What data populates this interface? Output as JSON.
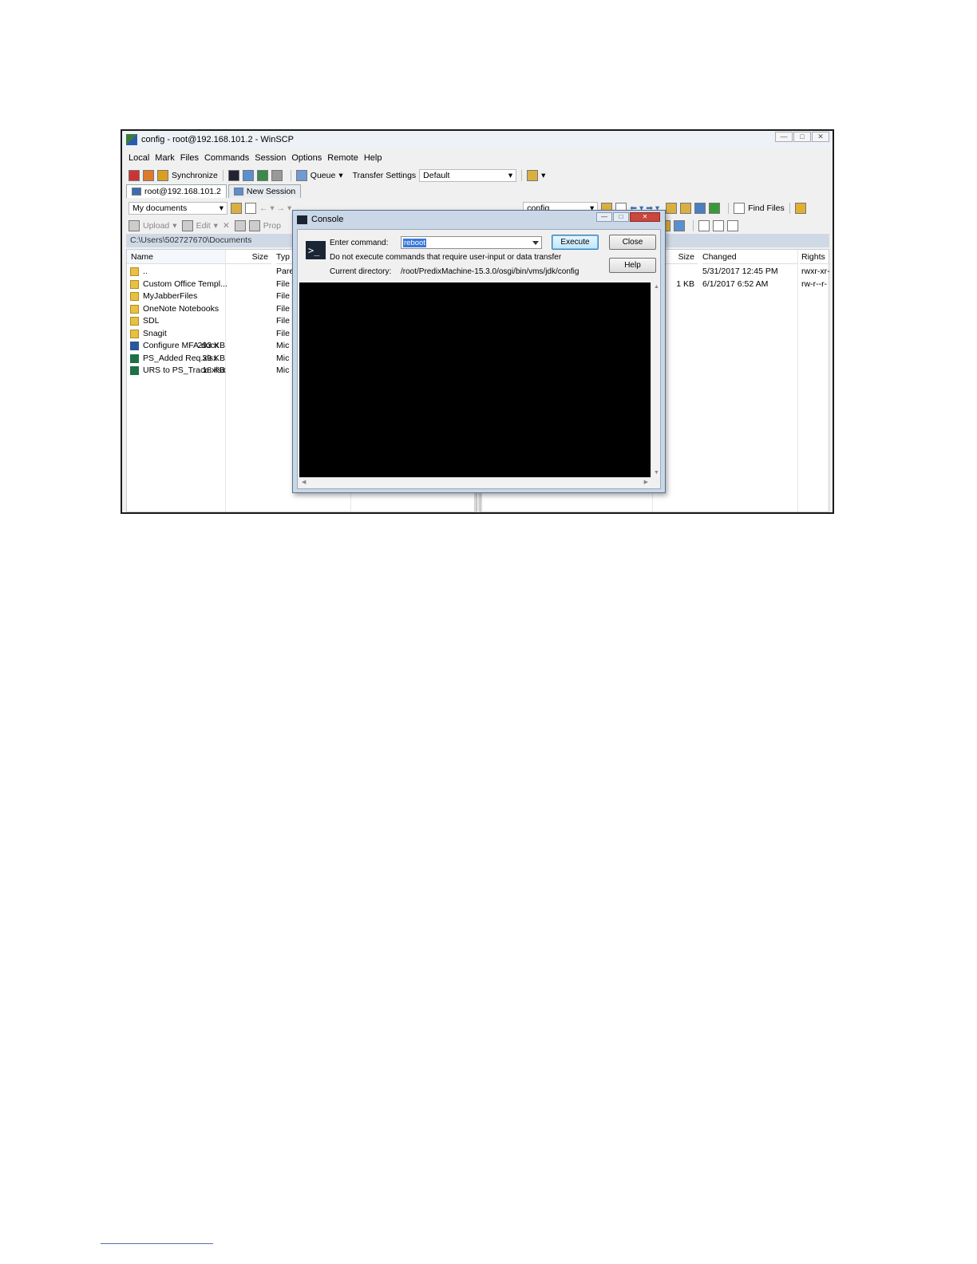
{
  "window": {
    "title": "config - root@192.168.101.2 - WinSCP",
    "min": "—",
    "max": "□",
    "close": "✕"
  },
  "menu": [
    "Local",
    "Mark",
    "Files",
    "Commands",
    "Session",
    "Options",
    "Remote",
    "Help"
  ],
  "toolbar": {
    "synchronize": "Synchronize",
    "queue": "Queue",
    "transfer_settings": "Transfer Settings",
    "transfer_value": "Default"
  },
  "tabs": {
    "session": "root@192.168.101.2",
    "new_session": "New Session"
  },
  "left_panel": {
    "location": "My documents",
    "path": "C:\\Users\\502727670\\Documents",
    "actions": {
      "upload": "Upload",
      "edit": "Edit",
      "properties": "Prop"
    },
    "columns": {
      "name": "Name",
      "size": "Size",
      "type": "Typ"
    },
    "rows": [
      {
        "name": "..",
        "size": "",
        "type": "Pare",
        "icon": "up"
      },
      {
        "name": "Custom Office Templ...",
        "size": "",
        "type": "File",
        "icon": "folder"
      },
      {
        "name": "MyJabberFiles",
        "size": "",
        "type": "File",
        "icon": "folder"
      },
      {
        "name": "OneNote Notebooks",
        "size": "",
        "type": "File",
        "icon": "folder"
      },
      {
        "name": "SDL",
        "size": "",
        "type": "File",
        "icon": "folder"
      },
      {
        "name": "Snagit",
        "size": "",
        "type": "File",
        "icon": "folder"
      },
      {
        "name": "Configure MFA.docx",
        "size": "293 KB",
        "type": "Mic",
        "icon": "word"
      },
      {
        "name": "PS_Added Req.xlsx",
        "size": "39 KB",
        "type": "Mic",
        "icon": "excel"
      },
      {
        "name": "URS to PS_Trace.xlsx",
        "size": "18 KB",
        "type": "Mic",
        "icon": "excel"
      }
    ]
  },
  "right_panel": {
    "location": "config",
    "find_files": "Find Files",
    "columns": {
      "size": "Size",
      "changed": "Changed",
      "rights": "Rights"
    },
    "rows": [
      {
        "size": "",
        "changed": "5/31/2017 12:45 PM",
        "rights": "rwxr-xr-"
      },
      {
        "size": "1 KB",
        "changed": "6/1/2017 6:52 AM",
        "rights": "rw-r--r-"
      }
    ]
  },
  "console": {
    "title": "Console",
    "enter_command_label": "Enter command:",
    "command_value": "reboot",
    "warning": "Do not execute commands that require user-input or data transfer",
    "current_dir_label": "Current directory:",
    "current_dir_value": "/root/PredixMachine-15.3.0/osgi/bin/vms/jdk/config",
    "execute": "Execute",
    "close": "Close",
    "help": "Help"
  }
}
